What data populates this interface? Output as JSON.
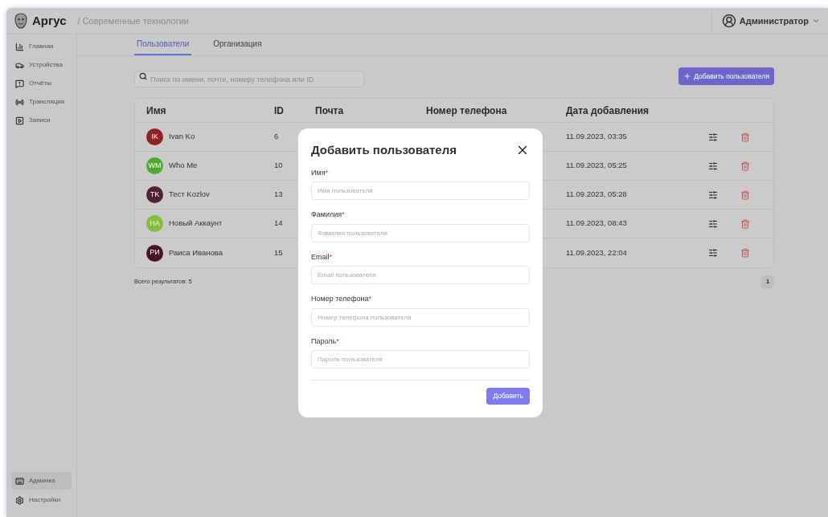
{
  "header": {
    "brand": "Аргус",
    "breadcrumb": "/ Современные технологии",
    "user": "Администратор"
  },
  "sidebar": {
    "items": [
      {
        "label": "Главная",
        "selected": false
      },
      {
        "label": "Устройства",
        "selected": false
      },
      {
        "label": "Отчёты",
        "selected": false
      },
      {
        "label": "Трансляция",
        "selected": false
      },
      {
        "label": "Записи",
        "selected": false
      }
    ],
    "bottom_items": [
      {
        "label": "Админка",
        "selected": true
      },
      {
        "label": "Настройки",
        "selected": false
      }
    ]
  },
  "tabs": [
    {
      "label": "Пользователи",
      "selected": true
    },
    {
      "label": "Организация",
      "selected": false
    }
  ],
  "search": {
    "placeholder": "Поиск по имени, почте, номеру телефона или ID"
  },
  "add_button": "Добавить пользователя",
  "table": {
    "columns": [
      "Имя",
      "ID",
      "Почта",
      "Номер телефона",
      "Дата добавления"
    ],
    "rows": [
      {
        "initials": "IK",
        "color": "#8e2226",
        "name": "Ivan Ko",
        "id": "6",
        "date": "11.09.2023, 03:35"
      },
      {
        "initials": "WM",
        "color": "#4ea92f",
        "name": "Who Me",
        "id": "10",
        "date": "11.09.2023, 05:25"
      },
      {
        "initials": "TK",
        "color": "#4f2432",
        "name": "Тест Kozlov",
        "id": "13",
        "date": "11.09.2023, 05:28"
      },
      {
        "initials": "HA",
        "color": "#84bd3f",
        "name": "Новый Аккаунт",
        "id": "14",
        "date": "11.09.2023, 08:43"
      },
      {
        "initials": "РИ",
        "color": "#4a1426",
        "name": "Раиса Иванова",
        "id": "15",
        "date": "11.09.2023, 22:04"
      }
    ]
  },
  "footer": {
    "total": "Всего результатов: 5",
    "pages": [
      {
        "label": "1",
        "selected": true
      }
    ]
  },
  "modal": {
    "title": "Добавить пользователя",
    "required_mark": "*",
    "fields": [
      {
        "label": "Имя",
        "required": true,
        "placeholder": "Имя пользователя"
      },
      {
        "label": "Фамилия",
        "required": true,
        "placeholder": "Фамилия пользователя"
      },
      {
        "label": "Email",
        "required": true,
        "placeholder": "Email пользователя"
      },
      {
        "label": "Номер телефона",
        "required": true,
        "placeholder": "Номер телефона пользователя"
      },
      {
        "label": "Пароль",
        "required": true,
        "placeholder": "Пароль пользователя"
      }
    ],
    "submit": "Добавить"
  }
}
